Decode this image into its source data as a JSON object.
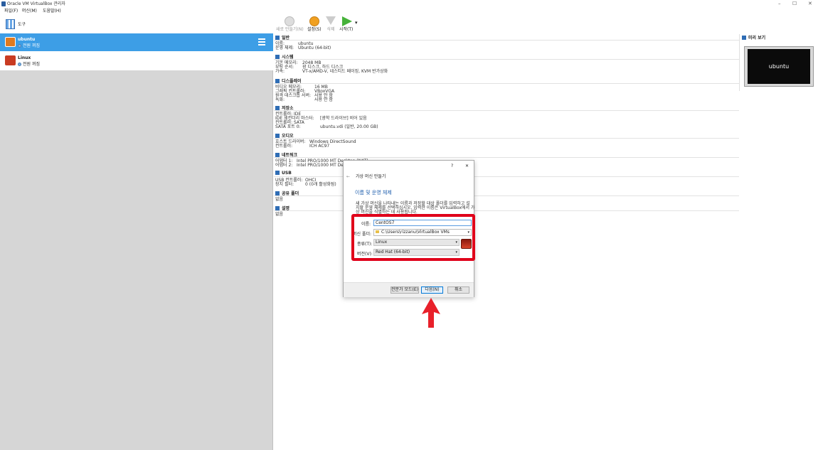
{
  "window": {
    "title": "Oracle VM VirtualBox 관리자",
    "minimize": "–",
    "maximize": "☐",
    "close": "✕"
  },
  "menu": [
    "파일(F)",
    "머신(M)",
    "도움말(H)"
  ],
  "tools": {
    "label": "도구"
  },
  "vms": [
    {
      "name": "ubuntu",
      "state": "전원 꺼짐"
    },
    {
      "name": "Linux",
      "state": "전원 꺼짐"
    }
  ],
  "toolbar": {
    "new": "새로 만들기(N)",
    "settings": "설정(S)",
    "discard": "삭제",
    "start": "시작(T)",
    "dropdown": "▾"
  },
  "sections": {
    "general": {
      "title": "일반",
      "rows": [
        {
          "k": "이름:",
          "v": "ubuntu"
        },
        {
          "k": "운영 체제:",
          "v": "Ubuntu (64-bit)"
        }
      ]
    },
    "system": {
      "title": "시스템",
      "rows": [
        {
          "k": "기본 메모리:",
          "v": "2048 MB"
        },
        {
          "k": "부팅 순서:",
          "v": "광 디스크, 하드 디스크"
        },
        {
          "k": "가속:",
          "v": "VT-x/AMD-V, 네스티드 페이징, KVM 반가상화"
        }
      ]
    },
    "display": {
      "title": "디스플레이",
      "rows": [
        {
          "k": "비디오 메모리:",
          "v": "16 MB"
        },
        {
          "k": "그래픽 컨트롤러:",
          "v": "VBoxVGA"
        },
        {
          "k": "원격 데스크톱 서버:",
          "v": "사용 안 함"
        },
        {
          "k": "녹화:",
          "v": "사용 안 함"
        }
      ]
    },
    "storage": {
      "title": "저장소",
      "rows": [
        {
          "k": "컨트롤러: IDE",
          "v": ""
        },
        {
          "k": " IDE 세컨더리 마스터:",
          "v": "[광학 드라이브] 비어 있음"
        },
        {
          "k": "컨트롤러: SATA",
          "v": ""
        },
        {
          "k": " SATA 포트 0:",
          "v": "ubuntu.vdi (일반, 20.00 GB)"
        }
      ]
    },
    "audio": {
      "title": "오디오",
      "rows": [
        {
          "k": "호스트 드라이버:",
          "v": "Windows DirectSound"
        },
        {
          "k": "컨트롤러:",
          "v": "ICH AC97"
        }
      ]
    },
    "network": {
      "title": "네트워크",
      "rows": [
        {
          "k": "어댑터 1:",
          "v": "Intel PRO/1000 MT Desktop (NAT)"
        },
        {
          "k": "어댑터 2:",
          "v": "Intel PRO/1000 MT Desktop (호스트 전용)"
        }
      ]
    },
    "usb": {
      "title": "USB",
      "rows": [
        {
          "k": "USB 컨트롤러:",
          "v": "OHCI"
        },
        {
          "k": "장치 필터:",
          "v": "0 (0개 활성화됨)"
        }
      ]
    },
    "shared": {
      "title": "공유 폴더",
      "rows": [
        {
          "k": "없음",
          "v": ""
        }
      ]
    },
    "description": {
      "title": "설명",
      "rows": [
        {
          "k": "없음",
          "v": ""
        }
      ]
    }
  },
  "preview": {
    "title": "미리 보기",
    "screen_text": "ubuntu"
  },
  "dialog": {
    "help": "?",
    "close": "✕",
    "back": "←",
    "title": "가상 머신 만들기",
    "heading": "이름 및 운영 체제",
    "desc_line1": "새 가상 머신을 나타내는 이름과 저장할 대상 폴더를 입력하고 설",
    "desc_line2": "치할 운영 체제를 선택하십시오. 입력한 이름은 VirtualBox에서 가",
    "desc_line3": "상 머신을 식별하는 데 사용됩니다.",
    "name_label": "이름:",
    "name_value": "CentOS7",
    "folder_label": "머신 폴더:",
    "folder_value": "C:\\Users\\rizzanu\\VirtualBox VMs",
    "type_label": "종류(T):",
    "type_value": "Linux",
    "version_label": "버전(V):",
    "version_value": "Red Hat (64-bit)",
    "expert_button": "전문가 모드(E)",
    "next_button": "다음(N)",
    "cancel_button": "취소"
  },
  "colors": {
    "highlight": "#e0001a",
    "selection": "#3d9ee6",
    "arrow": "#e8202a"
  }
}
